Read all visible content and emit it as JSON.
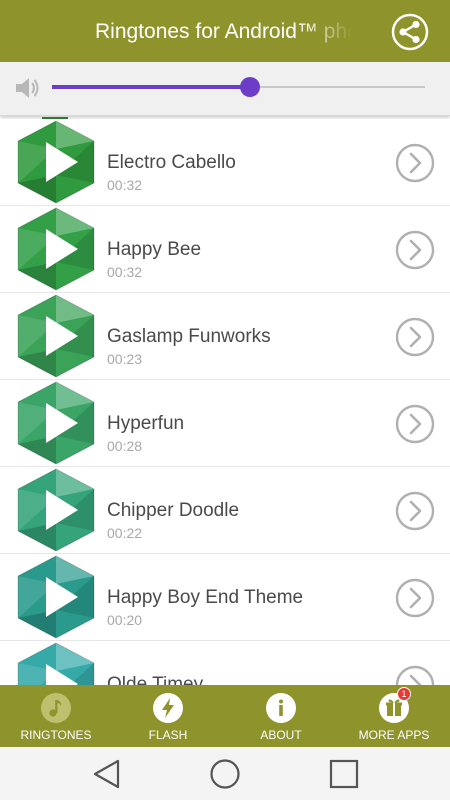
{
  "header": {
    "title": "Ringtones for Android™ phones"
  },
  "volume": {
    "level_percent": 53
  },
  "songs": [
    {
      "title": "Electro Cabello",
      "duration": "00:32",
      "color": "#2f9a3e"
    },
    {
      "title": "Happy Bee",
      "duration": "00:32",
      "color": "#33a048"
    },
    {
      "title": "Gaslamp Funworks",
      "duration": "00:23",
      "color": "#3ba358"
    },
    {
      "title": "Hyperfun",
      "duration": "00:28",
      "color": "#3aa567"
    },
    {
      "title": "Chipper Doodle",
      "duration": "00:22",
      "color": "#35a47a"
    },
    {
      "title": "Happy Boy End Theme",
      "duration": "00:20",
      "color": "#2a9a8c"
    },
    {
      "title": "Olde Timey",
      "duration": "",
      "color": "#36aaa9"
    }
  ],
  "bottom_nav": [
    {
      "label": "RINGTONES",
      "icon": "music-note-icon"
    },
    {
      "label": "FLASH",
      "icon": "flash-icon"
    },
    {
      "label": "ABOUT",
      "icon": "info-icon"
    },
    {
      "label": "MORE APPS",
      "icon": "gift-icon",
      "badge": "1"
    }
  ],
  "colors": {
    "brand": "#8f932c",
    "accent": "#6c3ec8",
    "badge": "#e53935"
  }
}
